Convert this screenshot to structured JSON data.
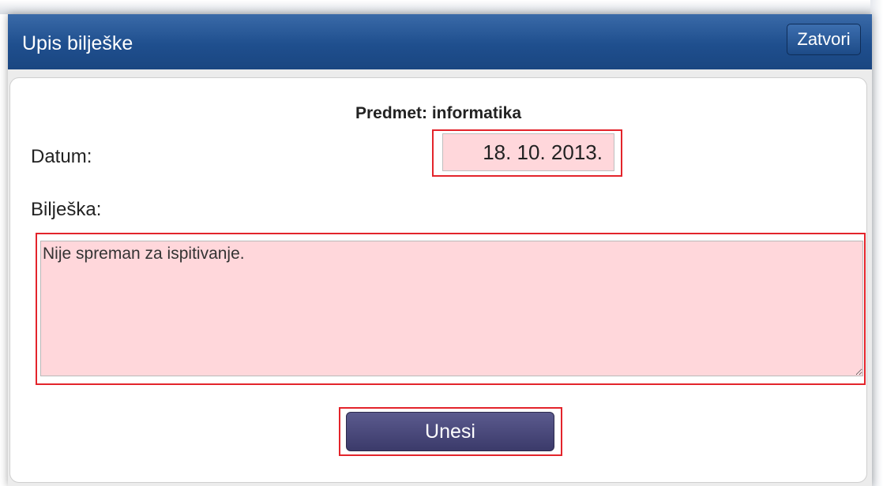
{
  "dialog": {
    "title": "Upis bilješke",
    "close_label": "Zatvori"
  },
  "form": {
    "subject": "Predmet: informatika",
    "date_label": "Datum:",
    "date_value": "18. 10. 2013.",
    "note_label": "Bilješka:",
    "note_value": "Nije spreman za ispitivanje.",
    "submit_label": "Unesi"
  },
  "colors": {
    "titlebar": "#1f4f8e",
    "highlight": "#e3242b",
    "field_bg": "#ffd7db",
    "submit_bg": "#47467a"
  }
}
